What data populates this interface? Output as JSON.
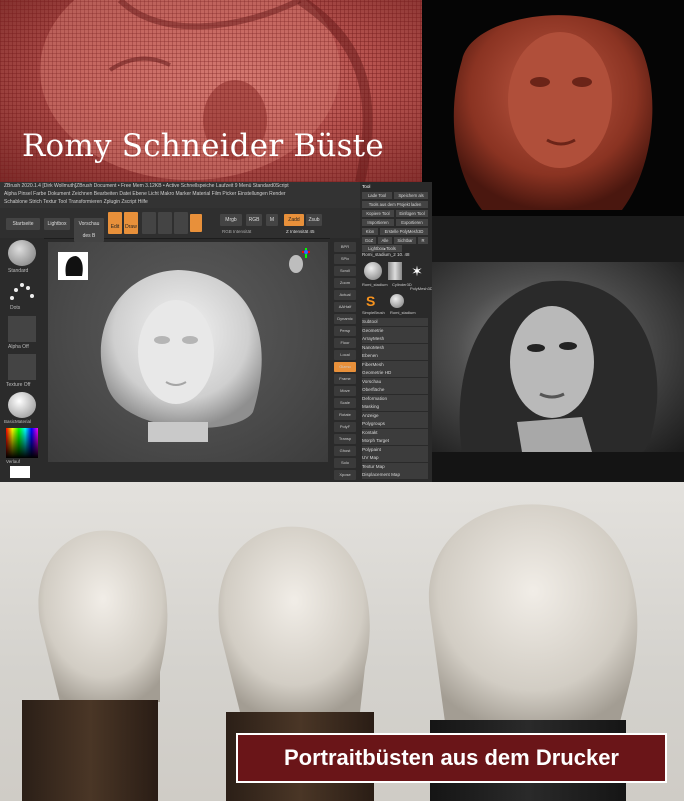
{
  "title": "Romy Schneider Büste",
  "banner": "Portraitbüsten aus dem Drucker",
  "zbrush": {
    "menu_line1": "ZBrush 2020.1.4 [Dirk Wollmuth]ZBrush Document   • Free Mem 3.12KB • Active   Schnellspeiche   Laufzeit 9   Menü   Standard0Script",
    "menu_line2": "Alpha  Pinsel  Farbe  Dokument  Zeichnen  Bearbeiten  Datei  Ebene  Licht  Makro  Marker  Material  Film  Picker  Einstellungen  Render",
    "menu_line3": "Schablone  Strich  Textur  Tool  Transformieren  Zplugin  Zscript  Hilfe",
    "tab_startseite": "Startseite",
    "tab_lightbox": "Lightbox",
    "tab_vorschau": "Vorschau des B",
    "tool_edit": "Edit",
    "tool_draw": "Draw",
    "mrgb": "Mrgb",
    "rgb": "RGB",
    "m": "M",
    "zadd": "Zadd",
    "zsub": "Zsub",
    "z_intensity": "Z Intensität 45",
    "rgb_intensity": "RGB Intensität",
    "left_standard": "Standard",
    "left_dots": "Dots",
    "left_alpha_off": "Alpha Off",
    "left_texture_off": "Texture Off",
    "left_material": "BasicMaterial",
    "left_verlauf": "Verlauf",
    "left_tauschen": "Tauschen"
  },
  "tool_panel": {
    "header": "Tool",
    "buttons": [
      "Lade Tool",
      "Speichern als",
      "Tools aus dem Projekt laden",
      "Kopiere Tool",
      "Einfügen Tool",
      "Importieren",
      "Exportieren",
      "Klon",
      "Erstelle PolyMesh3D",
      "GoZ",
      "Alle",
      "Sichtbar",
      "R",
      "Lightbox▸Tools"
    ],
    "current_tool": "Romi_stadium_2 10. 48",
    "tools": [
      "Romi_stadium",
      "Cylinder3D",
      "PolyMesh3D",
      "SimpleBrush",
      "Romi_stadium"
    ],
    "sections": [
      "Subtool",
      "Geometrie",
      "ArrayMesh",
      "NanoMesh",
      "Ebenen",
      "FiberMesh",
      "Geometrie HD",
      "Vorschau",
      "Oberfläche",
      "Deformation",
      "Masking",
      "Anzeige",
      "Polygroups",
      "Kontakt",
      "Morph Target",
      "Polypaint",
      "UV Map",
      "Textur Map",
      "Displacement Map"
    ]
  },
  "right_shelf": [
    "BPR",
    "SPix",
    "Scroll",
    "Zoom",
    "Actual",
    "AAHalf",
    "Dynamic",
    "Persp",
    "Floor",
    "Local",
    "Gizmo",
    "Frame",
    "Move",
    "Scale",
    "Rotate",
    "PolyF",
    "Transp",
    "Ghost",
    "Solo",
    "Xpose"
  ]
}
